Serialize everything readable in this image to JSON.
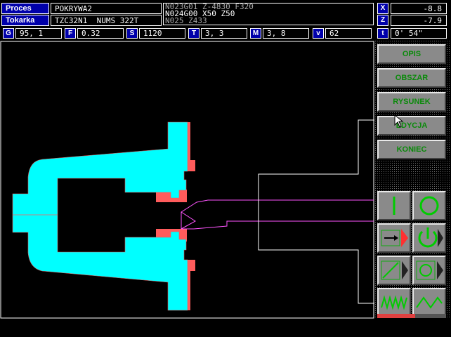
{
  "header": {
    "proces_label": "Proces",
    "proces_value": "POKRYWA2",
    "tokarka_label": "Tokarka",
    "tokarka_value": "TZC32N1  NUMS 322T",
    "nc_lines": [
      "N023G01 Z-4830 F320",
      "N024G00 X50 Z50",
      "N025 Z433"
    ],
    "x_label": "X",
    "x_value": "-8.8",
    "z_label": "Z",
    "z_value": "-7.9"
  },
  "status": {
    "g_label": "G",
    "g_value": "95, 1",
    "f_label": "F",
    "f_value": "0.32",
    "s_label": "S",
    "s_value": "1120",
    "t_label": "T",
    "t_value": "3, 3",
    "m_label": "M",
    "m_value": "3, 8",
    "v_label": "v",
    "v_value": "62",
    "time_label": "t",
    "time_value": "0' 54\""
  },
  "menu": {
    "opis": "OPIS",
    "obszar": "OBSZAR",
    "rysunek": "RYSUNEK",
    "edycja": "EDYCJA",
    "koniec": "KONIEC"
  },
  "tools": [
    "vertical-line-icon",
    "circle-icon",
    "feed-arrow-icon",
    "power-icon",
    "diagonal-line-icon",
    "rotate-icon",
    "zigzag-icon",
    "wave-icon"
  ],
  "progress": {
    "fraction": 0.55,
    "color": "#e04040"
  },
  "colors": {
    "part": "#00ffff",
    "material": "#ff5c5c",
    "toolpath": "#ff55ff",
    "button_text": "#0a8a0a"
  }
}
